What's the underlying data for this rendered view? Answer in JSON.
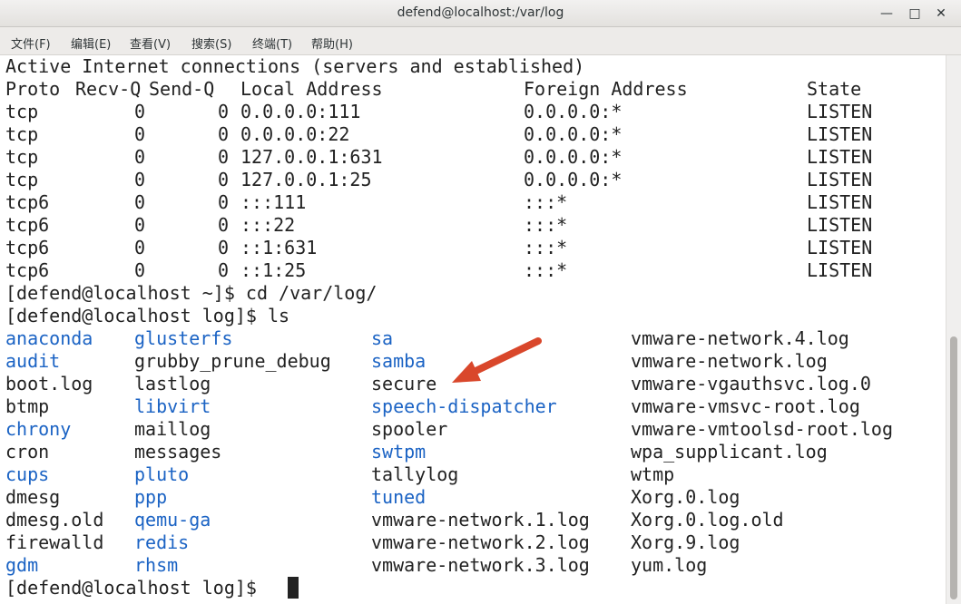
{
  "window": {
    "title": "defend@localhost:/var/log"
  },
  "menu": [
    "文件(F)",
    "编辑(E)",
    "查看(V)",
    "搜索(S)",
    "终端(T)",
    "帮助(H)"
  ],
  "netstat": {
    "header": "Active Internet connections (servers and established)",
    "columns": [
      "Proto",
      "Recv-Q",
      "Send-Q",
      "Local Address",
      "Foreign Address",
      "State"
    ],
    "rows": [
      [
        "tcp",
        "0",
        "0",
        "0.0.0.0:111",
        "0.0.0.0:*",
        "LISTEN"
      ],
      [
        "tcp",
        "0",
        "0",
        "0.0.0.0:22",
        "0.0.0.0:*",
        "LISTEN"
      ],
      [
        "tcp",
        "0",
        "0",
        "127.0.0.1:631",
        "0.0.0.0:*",
        "LISTEN"
      ],
      [
        "tcp",
        "0",
        "0",
        "127.0.0.1:25",
        "0.0.0.0:*",
        "LISTEN"
      ],
      [
        "tcp6",
        "0",
        "0",
        ":::111",
        ":::*",
        "LISTEN"
      ],
      [
        "tcp6",
        "0",
        "0",
        ":::22",
        ":::*",
        "LISTEN"
      ],
      [
        "tcp6",
        "0",
        "0",
        "::1:631",
        ":::*",
        "LISTEN"
      ],
      [
        "tcp6",
        "0",
        "0",
        "::1:25",
        ":::*",
        "LISTEN"
      ]
    ]
  },
  "commands": [
    "[defend@localhost ~]$ cd /var/log/",
    "[defend@localhost log]$ ls"
  ],
  "ls_rows": [
    [
      {
        "name": "anaconda",
        "dir": true
      },
      {
        "name": "glusterfs",
        "dir": true
      },
      {
        "name": "sa",
        "dir": true
      },
      {
        "name": "vmware-network.4.log",
        "dir": false
      }
    ],
    [
      {
        "name": "audit",
        "dir": true
      },
      {
        "name": "grubby_prune_debug",
        "dir": false
      },
      {
        "name": "samba",
        "dir": true
      },
      {
        "name": "vmware-network.log",
        "dir": false
      }
    ],
    [
      {
        "name": "boot.log",
        "dir": false
      },
      {
        "name": "lastlog",
        "dir": false
      },
      {
        "name": "secure",
        "dir": false
      },
      {
        "name": "vmware-vgauthsvc.log.0",
        "dir": false
      }
    ],
    [
      {
        "name": "btmp",
        "dir": false
      },
      {
        "name": "libvirt",
        "dir": true
      },
      {
        "name": "speech-dispatcher",
        "dir": true
      },
      {
        "name": "vmware-vmsvc-root.log",
        "dir": false
      }
    ],
    [
      {
        "name": "chrony",
        "dir": true
      },
      {
        "name": "maillog",
        "dir": false
      },
      {
        "name": "spooler",
        "dir": false
      },
      {
        "name": "vmware-vmtoolsd-root.log",
        "dir": false
      }
    ],
    [
      {
        "name": "cron",
        "dir": false
      },
      {
        "name": "messages",
        "dir": false
      },
      {
        "name": "swtpm",
        "dir": true
      },
      {
        "name": "wpa_supplicant.log",
        "dir": false
      }
    ],
    [
      {
        "name": "cups",
        "dir": true
      },
      {
        "name": "pluto",
        "dir": true
      },
      {
        "name": "tallylog",
        "dir": false
      },
      {
        "name": "wtmp",
        "dir": false
      }
    ],
    [
      {
        "name": "dmesg",
        "dir": false
      },
      {
        "name": "ppp",
        "dir": true
      },
      {
        "name": "tuned",
        "dir": true
      },
      {
        "name": "Xorg.0.log",
        "dir": false
      }
    ],
    [
      {
        "name": "dmesg.old",
        "dir": false
      },
      {
        "name": "qemu-ga",
        "dir": true
      },
      {
        "name": "vmware-network.1.log",
        "dir": false
      },
      {
        "name": "Xorg.0.log.old",
        "dir": false
      }
    ],
    [
      {
        "name": "firewalld",
        "dir": false
      },
      {
        "name": "redis",
        "dir": true
      },
      {
        "name": "vmware-network.2.log",
        "dir": false
      },
      {
        "name": "Xorg.9.log",
        "dir": false
      }
    ],
    [
      {
        "name": "gdm",
        "dir": true
      },
      {
        "name": "rhsm",
        "dir": true
      },
      {
        "name": "vmware-network.3.log",
        "dir": false
      },
      {
        "name": "yum.log",
        "dir": false
      }
    ]
  ],
  "prompt": "[defend@localhost log]$",
  "colors": {
    "dir": "#1b63c4",
    "text": "#222222",
    "arrow": "#d9472b"
  }
}
